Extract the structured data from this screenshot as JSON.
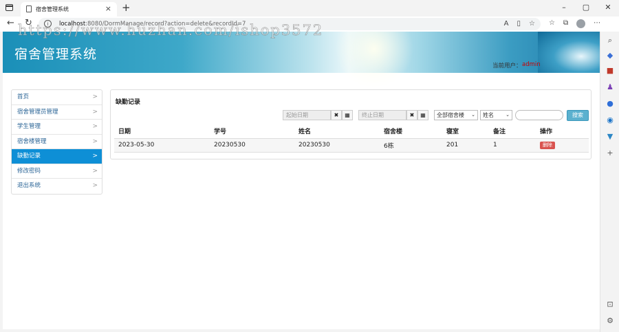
{
  "browser": {
    "tab_title": "宿舍管理系统",
    "url_host": "localhost",
    "url_rest": ":8080/DormManage/record?action=delete&recordId=7"
  },
  "watermark": "https://www.huzhan.com/ishop3572",
  "site": {
    "title": "宿舍管理系统",
    "user_label": "当前用户：",
    "user_name": "admin"
  },
  "menu": {
    "items": [
      {
        "label": "首页"
      },
      {
        "label": "宿舍管理员管理"
      },
      {
        "label": "学生管理"
      },
      {
        "label": "宿舍楼管理"
      },
      {
        "label": "缺勤记录"
      },
      {
        "label": "修改密码"
      },
      {
        "label": "退出系统"
      }
    ],
    "active_index": 4
  },
  "panel": {
    "title": "缺勤记录",
    "filter": {
      "start_date_placeholder": "起始日期",
      "end_date_placeholder": "终止日期",
      "building_select": "全部宿舍楼",
      "field_select": "姓名",
      "search_value": "",
      "search_button": "搜索"
    },
    "table": {
      "headers": [
        "日期",
        "学号",
        "姓名",
        "宿舍楼",
        "寝室",
        "备注",
        "操作"
      ],
      "rows": [
        {
          "date": "2023-05-30",
          "student_id": "20230530",
          "name": "20230530",
          "building": "6栋",
          "room": "201",
          "remark": "1",
          "action": "删除"
        }
      ]
    }
  }
}
